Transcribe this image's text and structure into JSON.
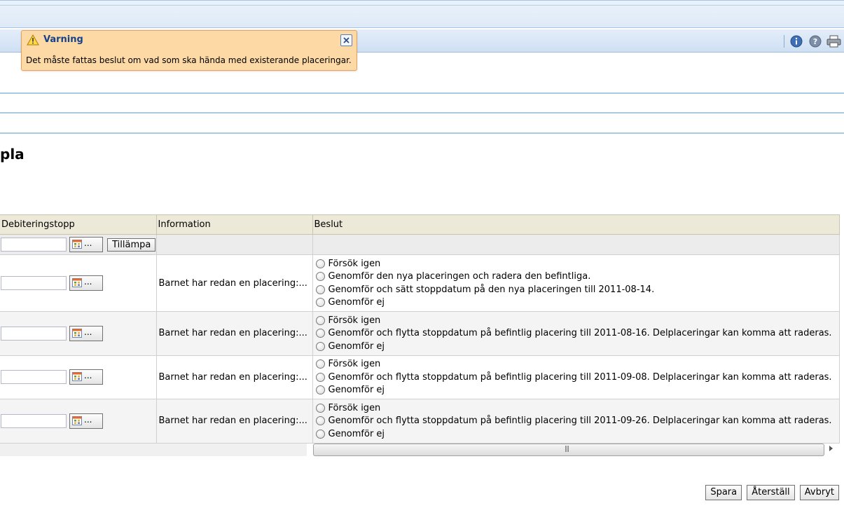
{
  "toolbar": {
    "icons": [
      "info-icon",
      "help-icon",
      "print-icon"
    ]
  },
  "warning": {
    "title": "Varning",
    "message": "Det måste fattas beslut om vad som ska hända med existerande placeringar."
  },
  "page": {
    "title": "pla"
  },
  "grid": {
    "headers": {
      "debitering": "Debiteringstopp",
      "information": "Information",
      "beslut": "Beslut"
    },
    "filter": {
      "apply_label": "Tillämpa",
      "cal_dots": "..."
    },
    "rows": [
      {
        "information": "Barnet har redan en placering:...",
        "options": [
          "Försök igen",
          "Genomför den nya placeringen och radera den befintliga.",
          "Genomför och sätt stoppdatum på den nya placeringen till 2011-08-14.",
          "Genomför ej"
        ]
      },
      {
        "information": "Barnet har redan en placering:...",
        "options": [
          "Försök igen",
          "Genomför och flytta stoppdatum på befintlig placering till 2011-08-16. Delplaceringar kan komma att raderas.",
          "Genomför ej"
        ]
      },
      {
        "information": "Barnet har redan en placering:...",
        "options": [
          "Försök igen",
          "Genomför och flytta stoppdatum på befintlig placering till 2011-09-08. Delplaceringar kan komma att raderas.",
          "Genomför ej"
        ]
      },
      {
        "information": "Barnet har redan en placering:...",
        "options": [
          "Försök igen",
          "Genomför och flytta stoppdatum på befintlig placering till 2011-09-26. Delplaceringar kan komma att raderas.",
          "Genomför ej"
        ]
      }
    ]
  },
  "footer": {
    "save": "Spara",
    "reset": "Återställ",
    "cancel": "Avbryt"
  }
}
